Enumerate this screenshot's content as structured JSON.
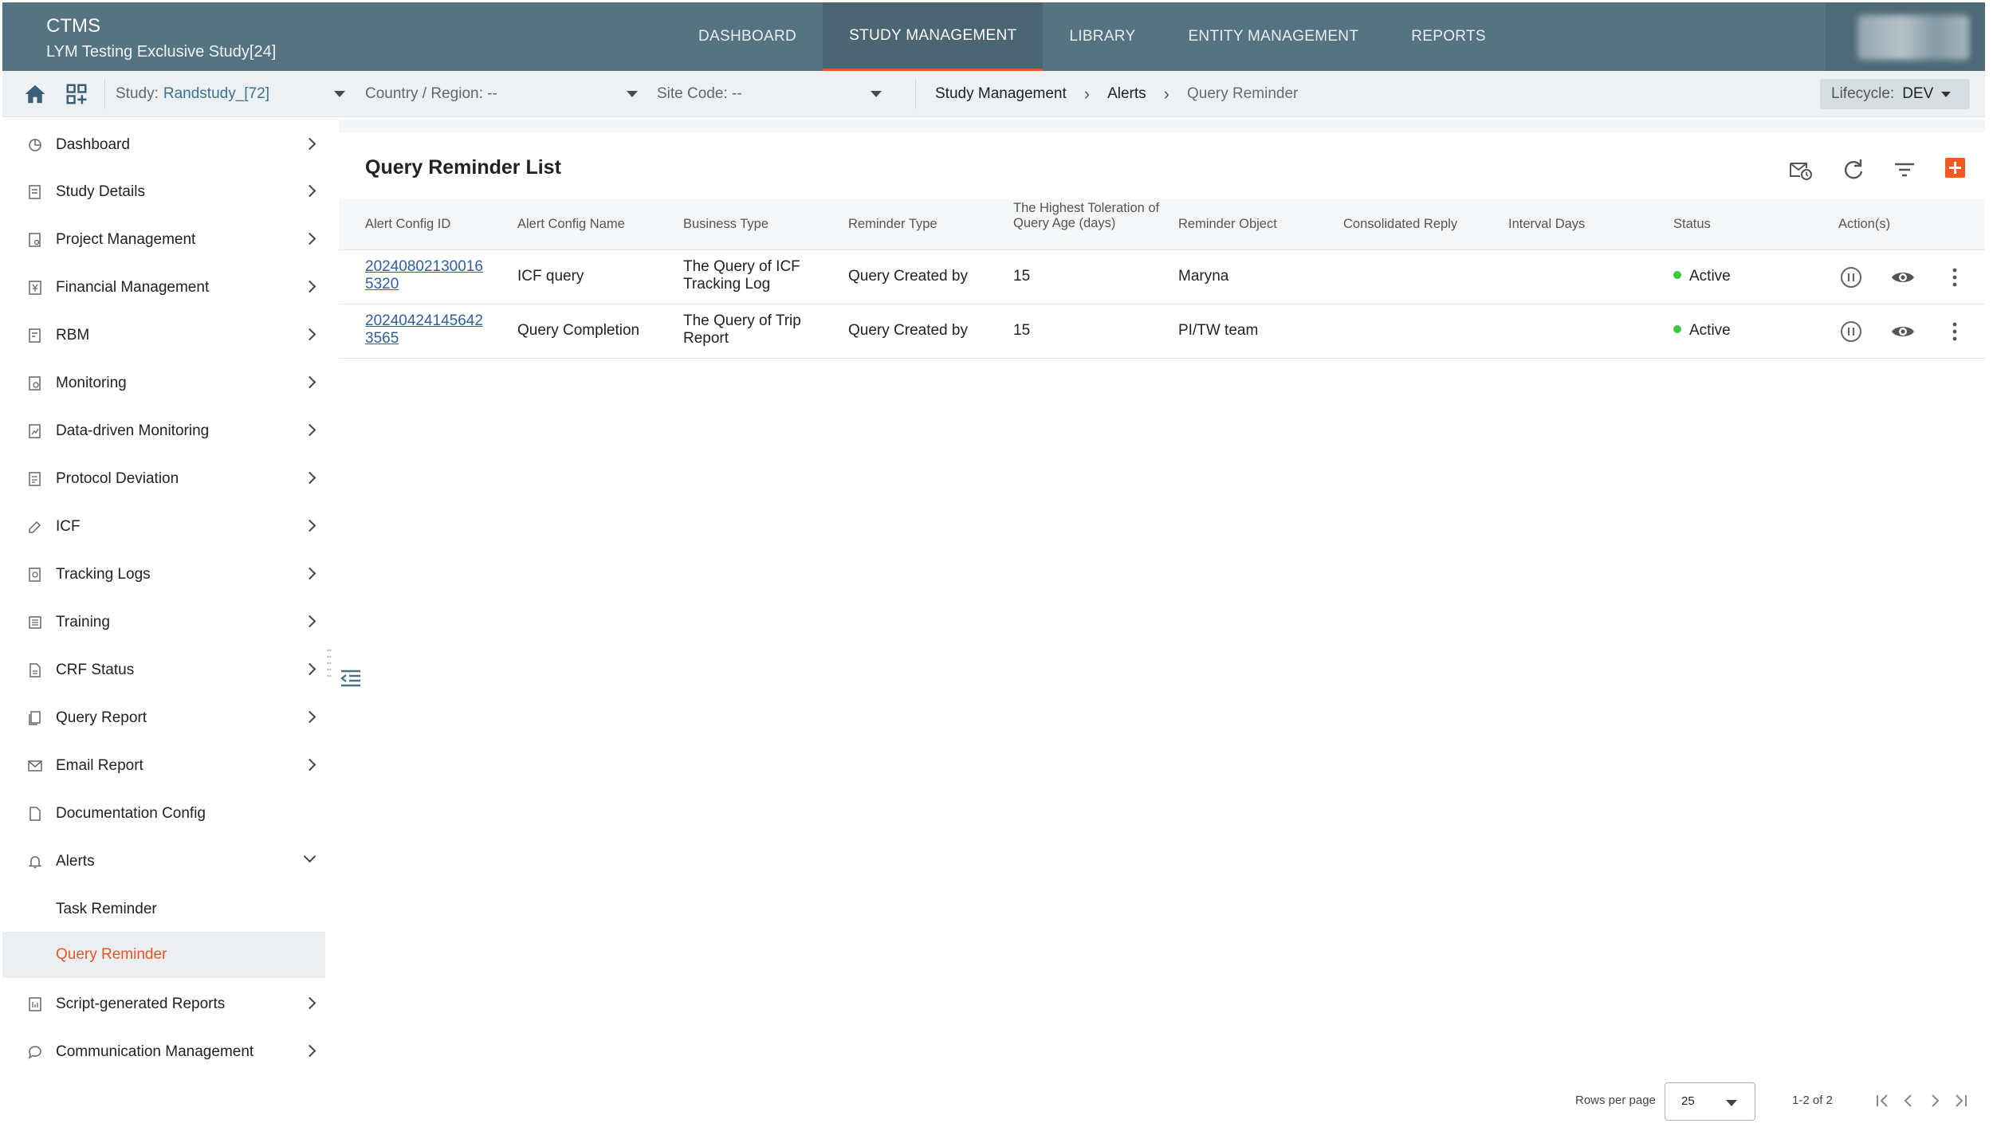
{
  "app": {
    "title": "CTMS",
    "subtitle": "LYM Testing Exclusive Study[24]"
  },
  "nav": {
    "tabs": [
      {
        "label": "DASHBOARD",
        "active": false
      },
      {
        "label": "STUDY MANAGEMENT",
        "active": true
      },
      {
        "label": "LIBRARY",
        "active": false
      },
      {
        "label": "ENTITY MANAGEMENT",
        "active": false
      },
      {
        "label": "REPORTS",
        "active": false
      }
    ]
  },
  "filters": {
    "study_label": "Study:",
    "study_value": "Randstudy_[72]",
    "country_label": "Country / Region: --",
    "site_label": "Site Code: --"
  },
  "breadcrumb": [
    "Study Management",
    "Alerts",
    "Query Reminder"
  ],
  "lifecycle": {
    "label": "Lifecycle:",
    "value": "DEV"
  },
  "sidebar": {
    "items": [
      {
        "label": "Dashboard",
        "icon": "dashboard-icon",
        "chevron": "right"
      },
      {
        "label": "Study Details",
        "icon": "study-details-icon",
        "chevron": "right"
      },
      {
        "label": "Project Management",
        "icon": "project-icon",
        "chevron": "right"
      },
      {
        "label": "Financial Management",
        "icon": "finance-icon",
        "chevron": "right"
      },
      {
        "label": "RBM",
        "icon": "rbm-icon",
        "chevron": "right"
      },
      {
        "label": "Monitoring",
        "icon": "monitoring-icon",
        "chevron": "right"
      },
      {
        "label": "Data-driven Monitoring",
        "icon": "data-monitoring-icon",
        "chevron": "right"
      },
      {
        "label": "Protocol Deviation",
        "icon": "protocol-icon",
        "chevron": "right"
      },
      {
        "label": "ICF",
        "icon": "edit-icon",
        "chevron": "right"
      },
      {
        "label": "Tracking Logs",
        "icon": "tracking-icon",
        "chevron": "right"
      },
      {
        "label": "Training",
        "icon": "training-icon",
        "chevron": "right"
      },
      {
        "label": "CRF Status",
        "icon": "crf-icon",
        "chevron": "right"
      },
      {
        "label": "Query Report",
        "icon": "query-report-icon",
        "chevron": "right"
      },
      {
        "label": "Email Report",
        "icon": "mail-icon",
        "chevron": "right"
      },
      {
        "label": "Documentation Config",
        "icon": "document-icon",
        "chevron": ""
      },
      {
        "label": "Alerts",
        "icon": "bell-icon",
        "chevron": "down"
      },
      {
        "label": "Task Reminder",
        "icon": "",
        "chevron": ""
      },
      {
        "label": "Query Reminder",
        "icon": "",
        "chevron": "",
        "active": true
      },
      {
        "label": "Script-generated Reports",
        "icon": "script-icon",
        "chevron": "right"
      },
      {
        "label": "Communication Management",
        "icon": "chat-icon",
        "chevron": "right"
      }
    ]
  },
  "list": {
    "title": "Query Reminder List",
    "columns": [
      "Alert Config ID",
      "Alert Config Name",
      "Business Type",
      "Reminder Type",
      "The Highest Toleration of Query Age (days)",
      "Reminder Object",
      "Consolidated Reply",
      "Interval Days",
      "Status",
      "Action(s)"
    ],
    "rows": [
      {
        "id_line1": "20240802130016",
        "id_line2": "5320",
        "name": "ICF query",
        "business_line1": "The Query of ICF",
        "business_line2": "Tracking Log",
        "reminder_type": "Query Created by",
        "toleration": "15",
        "object": "Maryna",
        "consolidated": "",
        "interval": "",
        "status": "Active"
      },
      {
        "id_line1": "20240424145642",
        "id_line2": "3565",
        "name": "Query Completion",
        "business_line1": "The Query of Trip",
        "business_line2": "Report",
        "reminder_type": "Query Created by",
        "toleration": "15",
        "object": "PI/TW team",
        "consolidated": "",
        "interval": "",
        "status": "Active"
      }
    ]
  },
  "pagination": {
    "rows_per_page_label": "Rows per page",
    "rows_per_page": "25",
    "range": "1-2 of 2"
  },
  "colors": {
    "header": "#557381",
    "accent": "#e8542a",
    "link": "#2e5f9e",
    "status_active": "#3cc93c"
  }
}
